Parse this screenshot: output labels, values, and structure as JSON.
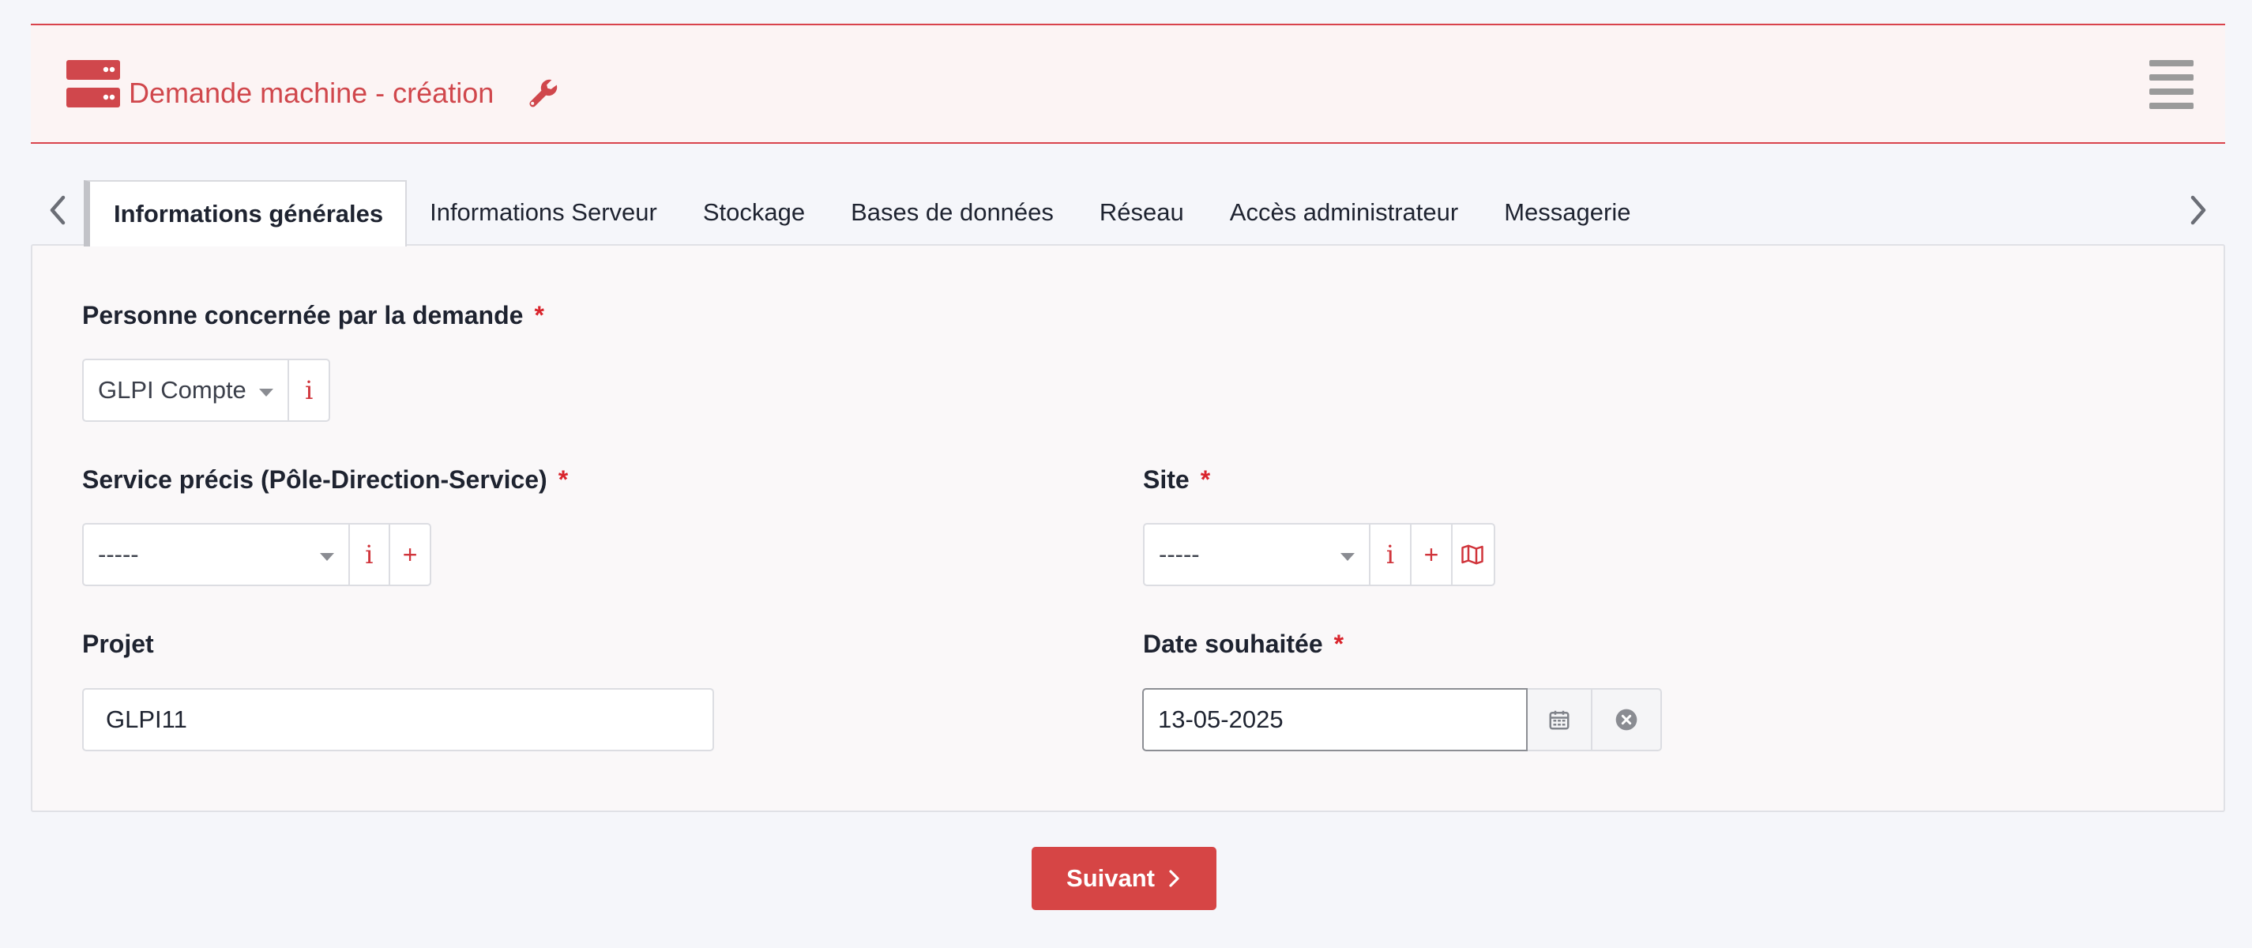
{
  "header": {
    "title": "Demande machine - création",
    "logo_icon": "server-icon",
    "wrench_icon": "wrench-icon",
    "menu_icon": "hamburger-menu-icon",
    "accent_color": "#d0474c"
  },
  "tabs": [
    {
      "label": "Informations générales",
      "active": true
    },
    {
      "label": "Informations Serveur",
      "active": false
    },
    {
      "label": "Stockage",
      "active": false
    },
    {
      "label": "Bases de données",
      "active": false
    },
    {
      "label": "Réseau",
      "active": false
    },
    {
      "label": "Accès administrateur",
      "active": false
    },
    {
      "label": "Messagerie",
      "active": false
    }
  ],
  "form": {
    "person": {
      "label": "Personne concernée par la demande",
      "required_mark": "*",
      "value": "GLPI Compte",
      "info_label": "i"
    },
    "service": {
      "label": "Service précis (Pôle-Direction-Service)",
      "required_mark": "*",
      "value": "-----",
      "info_label": "i",
      "add_label": "+"
    },
    "site": {
      "label": "Site",
      "required_mark": "*",
      "value": "-----",
      "info_label": "i",
      "add_label": "+",
      "map_icon": "map-icon"
    },
    "project": {
      "label": "Projet",
      "value": "GLPI11"
    },
    "date": {
      "label": "Date souhaitée",
      "required_mark": "*",
      "value": "13-05-2025",
      "calendar_icon": "calendar-icon",
      "clear_icon": "clear-circle-icon"
    }
  },
  "actions": {
    "next_label": "Suivant",
    "next_color": "#d64545"
  }
}
